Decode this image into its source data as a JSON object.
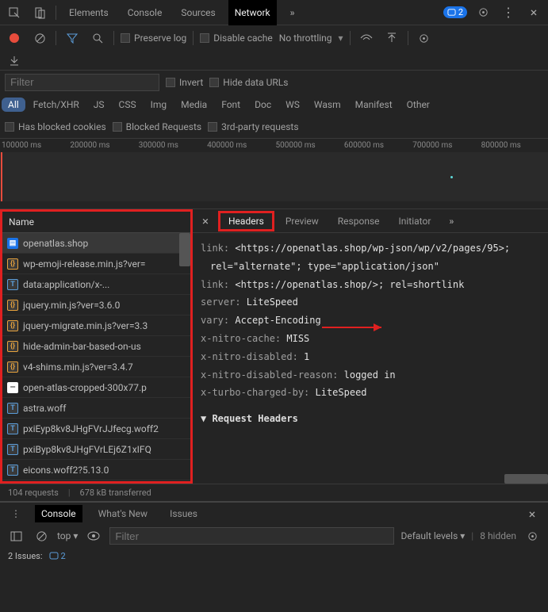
{
  "topTabs": [
    "Elements",
    "Console",
    "Sources",
    "Network"
  ],
  "activeTab": "Network",
  "issuesBadge": 2,
  "toolbar2": {
    "preserveLog": "Preserve log",
    "disableCache": "Disable cache",
    "throttling": "No throttling"
  },
  "filterRow": {
    "placeholder": "Filter",
    "invert": "Invert",
    "hideData": "Hide data URLs"
  },
  "typeFilters": [
    "All",
    "Fetch/XHR",
    "JS",
    "CSS",
    "Img",
    "Media",
    "Font",
    "Doc",
    "WS",
    "Wasm",
    "Manifest",
    "Other"
  ],
  "filterRow2": {
    "blockedCookies": "Has blocked cookies",
    "blockedReq": "Blocked Requests",
    "thirdParty": "3rd-party requests"
  },
  "timelineTicks": [
    "100000 ms",
    "200000 ms",
    "300000 ms",
    "400000 ms",
    "500000 ms",
    "600000 ms",
    "700000 ms",
    "800000 ms"
  ],
  "nameHeader": "Name",
  "requests": [
    {
      "icon": "doc",
      "name": "openatlas.shop",
      "sel": true
    },
    {
      "icon": "js",
      "name": "wp-emoji-release.min.js?ver="
    },
    {
      "icon": "css",
      "name": "data:application/x-..."
    },
    {
      "icon": "js",
      "name": "jquery.min.js?ver=3.6.0"
    },
    {
      "icon": "js",
      "name": "jquery-migrate.min.js?ver=3.3"
    },
    {
      "icon": "js",
      "name": "hide-admin-bar-based-on-us"
    },
    {
      "icon": "js",
      "name": "v4-shims.min.js?ver=3.4.7"
    },
    {
      "icon": "img",
      "name": "open-atlas-cropped-300x77.p"
    },
    {
      "icon": "font",
      "name": "astra.woff"
    },
    {
      "icon": "font",
      "name": "pxiEyp8kv8JHgFVrJJfecg.woff2"
    },
    {
      "icon": "font",
      "name": "pxiByp8kv8JHgFVrLEj6Z1xIFQ"
    },
    {
      "icon": "font",
      "name": "eicons.woff2?5.13.0"
    }
  ],
  "status": {
    "requests": "104 requests",
    "transferred": "678 kB transferred"
  },
  "detailTabs": [
    "Headers",
    "Preview",
    "Response",
    "Initiator"
  ],
  "activeDetailTab": "Headers",
  "headers": {
    "link1_full": "<https://openatlas.shop/wp-json/wp/v2/pages/95>; rel=\"alternate\"; type=\"application/json\"",
    "link2_full": "<https://openatlas.shop/>; rel=shortlink",
    "server": "LiteSpeed",
    "vary": "Accept-Encoding",
    "xnitrocache": "MISS",
    "xnitrodisabled": "1",
    "xnitroreason": "logged in",
    "xturbo": "LiteSpeed"
  },
  "requestHeadersTitle": "Request Headers",
  "drawer": {
    "tabs": [
      "Console",
      "What's New",
      "Issues"
    ],
    "active": "Console",
    "top": "top",
    "filterPlaceholder": "Filter",
    "levels": "Default levels",
    "hidden": "8 hidden",
    "issuesLine": "2 Issues:",
    "issuesCount": 2
  }
}
